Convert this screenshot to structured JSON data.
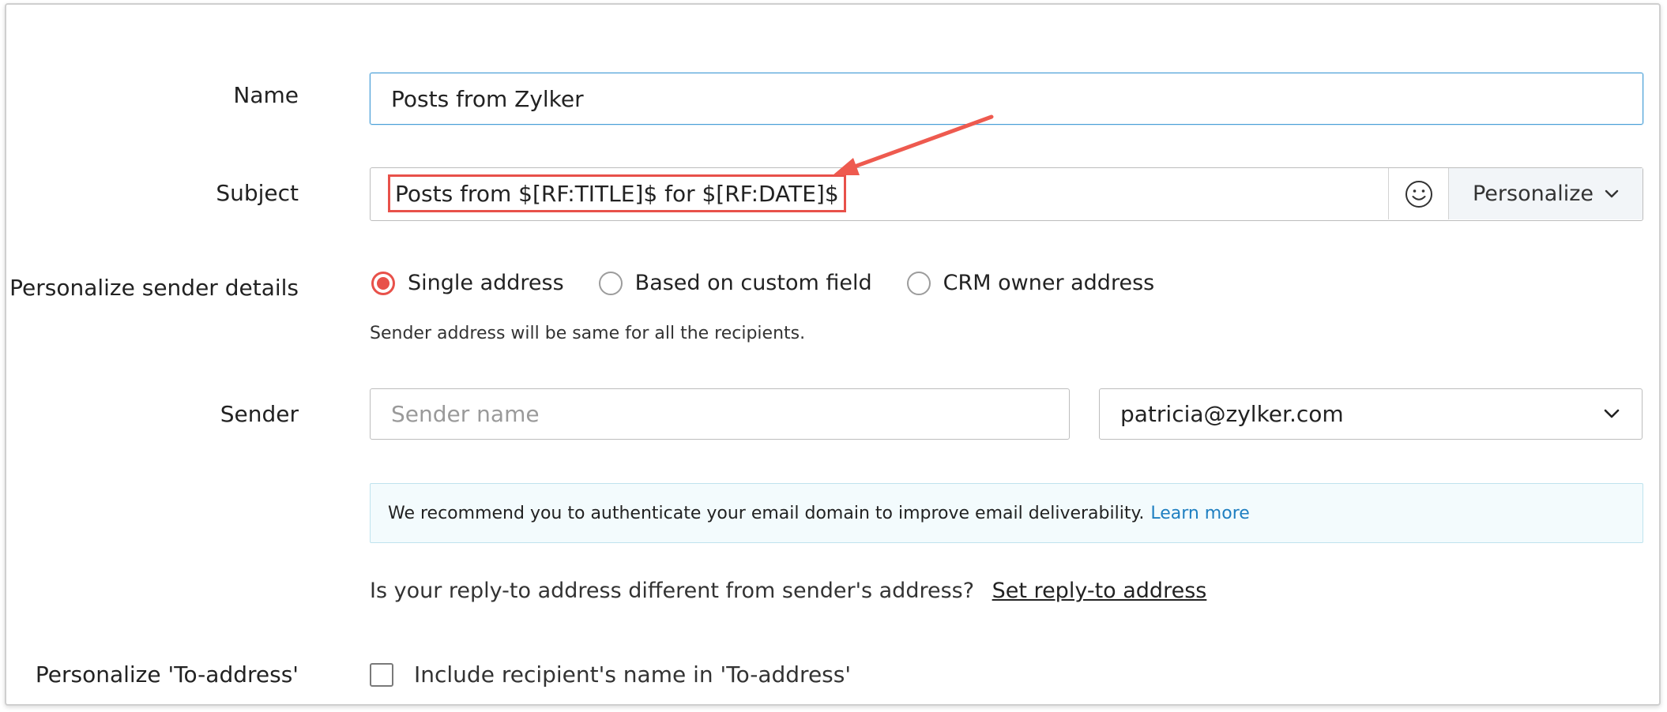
{
  "form": {
    "name_label": "Name",
    "name_value": "Posts from Zylker",
    "subject_label": "Subject",
    "subject_value": "Posts from $[RF:TITLE]$ for $[RF:DATE]$",
    "personalize_button": "Personalize",
    "sender_details_label": "Personalize sender details",
    "sender_options": [
      "Single address",
      "Based on custom field",
      "CRM owner address"
    ],
    "sender_selected": "Single address",
    "sender_hint": "Sender address will be same for all the recipients.",
    "sender_label": "Sender",
    "sender_name_placeholder": "Sender name",
    "sender_email_selected": "patricia@zylker.com",
    "info_text": "We recommend you to authenticate your email domain to improve email deliverability.",
    "info_link": "Learn more",
    "reply_question": "Is your reply-to address different from sender's address?",
    "reply_link": "Set reply-to address",
    "to_address_label": "Personalize 'To-address'",
    "to_address_checkbox_label": "Include recipient's name in 'To-address'",
    "to_address_checked": false
  },
  "icons": {
    "emoji": "smiley-icon",
    "dropdown": "chevron-down-icon",
    "annotation": "red-arrow-annotation"
  },
  "colors": {
    "accent": "#e8514a",
    "link": "#1f7fc1",
    "focus_border": "#4a9fd6",
    "info_bg": "#f3fbfd",
    "personalize_bg": "#f2f5f8"
  }
}
